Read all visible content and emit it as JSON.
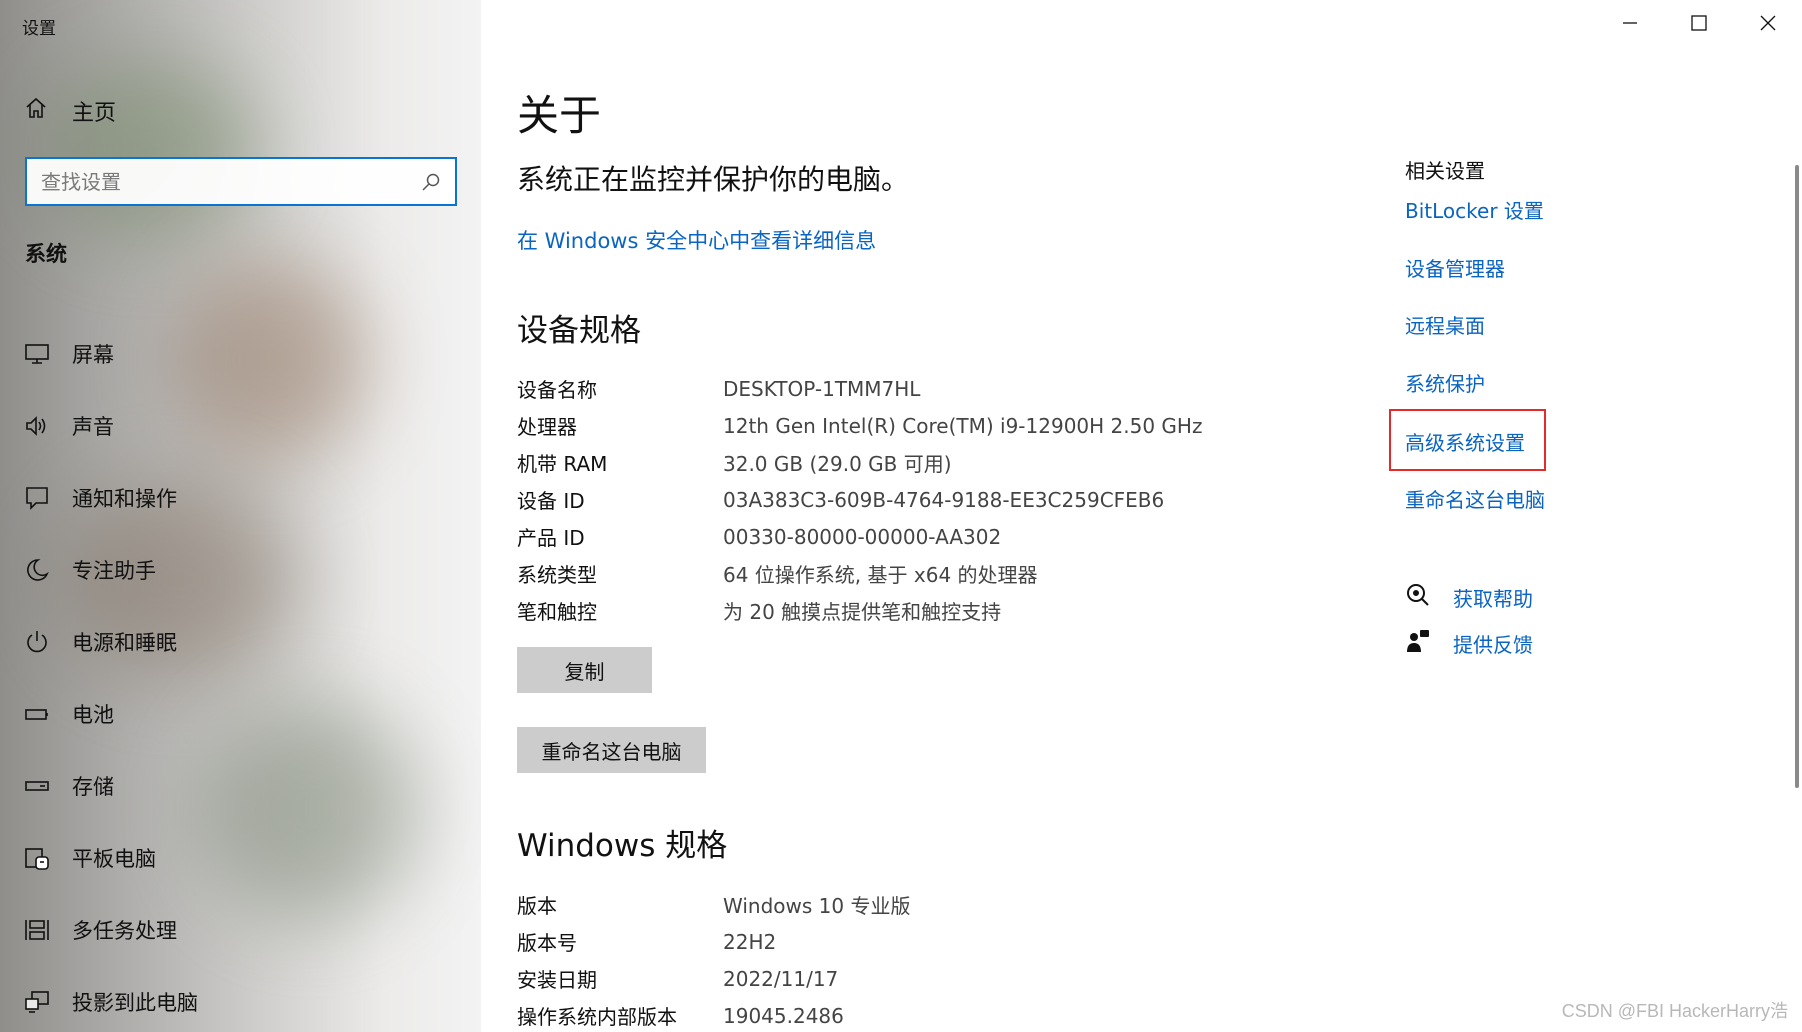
{
  "window": {
    "title": "设置",
    "minimize_icon": "minimize-icon",
    "maximize_icon": "maximize-icon",
    "close_icon": "close-icon"
  },
  "sidebar": {
    "home_label": "主页",
    "search_placeholder": "查找设置",
    "section_label": "系统",
    "items": [
      {
        "label": "屏幕",
        "icon": "display-icon"
      },
      {
        "label": "声音",
        "icon": "speaker-icon"
      },
      {
        "label": "通知和操作",
        "icon": "notification-icon"
      },
      {
        "label": "专注助手",
        "icon": "moon-icon"
      },
      {
        "label": "电源和睡眠",
        "icon": "power-icon"
      },
      {
        "label": "电池",
        "icon": "battery-icon"
      },
      {
        "label": "存储",
        "icon": "storage-icon"
      },
      {
        "label": "平板电脑",
        "icon": "tablet-icon"
      },
      {
        "label": "多任务处理",
        "icon": "multitask-icon"
      },
      {
        "label": "投影到此电脑",
        "icon": "project-icon"
      }
    ]
  },
  "main": {
    "title": "关于",
    "protect_text": "系统正在监控并保护你的电脑。",
    "security_link": "在 Windows 安全中心中查看详细信息",
    "device_spec_title": "设备规格",
    "device_specs": [
      {
        "key": "设备名称",
        "value": "DESKTOP-1TMM7HL"
      },
      {
        "key": "处理器",
        "value": "12th Gen Intel(R) Core(TM) i9-12900H   2.50 GHz"
      },
      {
        "key": "机带 RAM",
        "value": "32.0 GB (29.0 GB 可用)"
      },
      {
        "key": "设备 ID",
        "value": "03A383C3-609B-4764-9188-EE3C259CFEB6"
      },
      {
        "key": "产品 ID",
        "value": "00330-80000-00000-AA302"
      },
      {
        "key": "系统类型",
        "value": "64 位操作系统, 基于 x64 的处理器"
      },
      {
        "key": "笔和触控",
        "value": "为 20 触摸点提供笔和触控支持"
      }
    ],
    "copy_button": "复制",
    "rename_button": "重命名这台电脑",
    "windows_spec_title": "Windows 规格",
    "windows_specs": [
      {
        "key": "版本",
        "value": "Windows 10 专业版"
      },
      {
        "key": "版本号",
        "value": "22H2"
      },
      {
        "key": "安装日期",
        "value": "2022/11/17"
      },
      {
        "key": "操作系统内部版本",
        "value": "19045.2486"
      }
    ]
  },
  "related": {
    "title": "相关设置",
    "links": [
      "BitLocker 设置",
      "设备管理器",
      "远程桌面",
      "系统保护",
      "高级系统设置",
      "重命名这台电脑"
    ],
    "highlighted_link": "高级系统设置",
    "highlight_color": "#e52a2a",
    "help": [
      {
        "label": "获取帮助",
        "icon": "help-chat-icon"
      },
      {
        "label": "提供反馈",
        "icon": "feedback-icon"
      }
    ]
  },
  "watermark": "CSDN @FBI HackerHarry浩",
  "colors": {
    "accent": "#0a74d4",
    "link": "#0a64c2",
    "button_bg": "#cccccc"
  }
}
